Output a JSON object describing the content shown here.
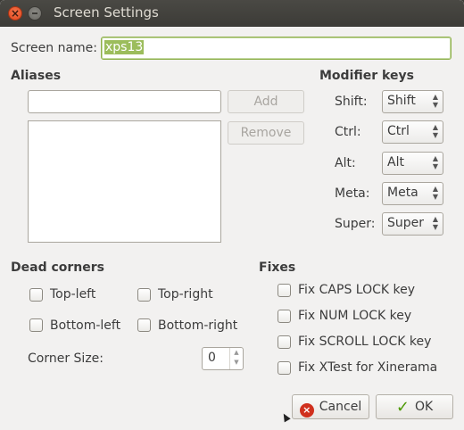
{
  "window": {
    "title": "Screen Settings"
  },
  "screen_name": {
    "label": "Screen name:",
    "value": "xps13"
  },
  "aliases": {
    "heading": "Aliases",
    "input_value": "",
    "add_label": "Add",
    "remove_label": "Remove",
    "items": []
  },
  "modifier_keys": {
    "heading": "Modifier keys",
    "rows": [
      {
        "label": "Shift:",
        "value": "Shift"
      },
      {
        "label": "Ctrl:",
        "value": "Ctrl"
      },
      {
        "label": "Alt:",
        "value": "Alt"
      },
      {
        "label": "Meta:",
        "value": "Meta"
      },
      {
        "label": "Super:",
        "value": "Super"
      }
    ]
  },
  "dead_corners": {
    "heading": "Dead corners",
    "top_left": "Top-left",
    "top_right": "Top-right",
    "bottom_left": "Bottom-left",
    "bottom_right": "Bottom-right",
    "corner_size_label": "Corner Size:",
    "corner_size_value": "0"
  },
  "fixes": {
    "heading": "Fixes",
    "items": [
      "Fix CAPS LOCK key",
      "Fix NUM LOCK key",
      "Fix SCROLL LOCK key",
      "Fix XTest for Xinerama"
    ]
  },
  "buttons": {
    "cancel_label": "Cancel",
    "ok_label": "OK"
  }
}
